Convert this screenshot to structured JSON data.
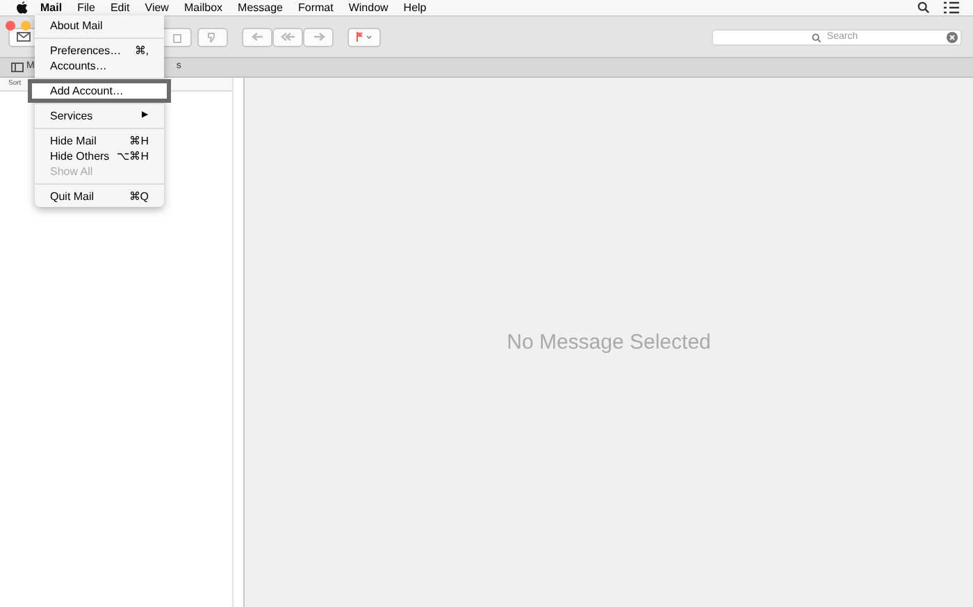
{
  "menubar": {
    "items": [
      {
        "label": "Mail",
        "selected": true
      },
      {
        "label": "File",
        "selected": false
      },
      {
        "label": "Edit",
        "selected": false
      },
      {
        "label": "View",
        "selected": false
      },
      {
        "label": "Mailbox",
        "selected": false
      },
      {
        "label": "Message",
        "selected": false
      },
      {
        "label": "Format",
        "selected": false
      },
      {
        "label": "Window",
        "selected": false
      },
      {
        "label": "Help",
        "selected": false
      }
    ]
  },
  "menu": {
    "sections": [
      [
        {
          "label": "About Mail",
          "kind": "item",
          "disabled": false,
          "selected": false
        }
      ],
      [
        {
          "label": "Preferences…",
          "shortcut": "⌘,",
          "kind": "item",
          "disabled": false,
          "selected": false
        },
        {
          "label": "Accounts…",
          "kind": "item",
          "disabled": false,
          "selected": false
        }
      ],
      [
        {
          "label": "Add Account…",
          "kind": "item",
          "disabled": false,
          "selected": true
        }
      ],
      [
        {
          "label": "Services",
          "kind": "submenu",
          "arrow": "▶",
          "disabled": false,
          "selected": false
        }
      ],
      [
        {
          "label": "Hide Mail",
          "shortcut": "⌘H",
          "kind": "item",
          "disabled": false,
          "selected": false
        },
        {
          "label": "Hide Others",
          "shortcut": "⌥⌘H",
          "kind": "item",
          "disabled": false,
          "selected": false
        },
        {
          "label": "Show All",
          "kind": "item",
          "disabled": true,
          "selected": false
        }
      ],
      [
        {
          "label": "Quit Mail",
          "shortcut": "⌘Q",
          "kind": "item",
          "disabled": false,
          "selected": false
        }
      ]
    ]
  },
  "favorites_bar": {
    "mailboxes_label": "M",
    "right_fragment": "s"
  },
  "message_list": {
    "sort_label": "Sort"
  },
  "search": {
    "placeholder": "Search"
  },
  "viewer": {
    "empty_text": "No Message Selected"
  }
}
